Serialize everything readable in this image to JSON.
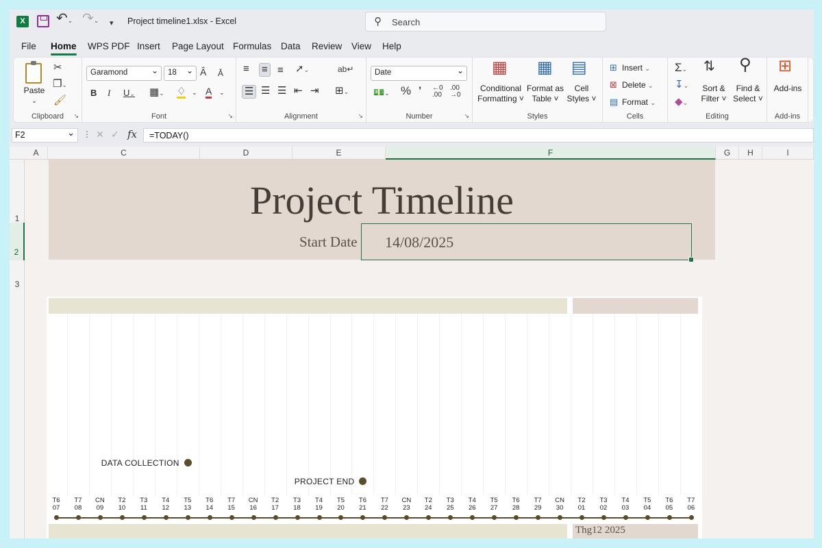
{
  "titlebar": {
    "doc_title": "Project timeline1.xlsx  -  Excel",
    "search_placeholder": "Search"
  },
  "menu": [
    "File",
    "Home",
    "WPS PDF",
    "Insert",
    "Page Layout",
    "Formulas",
    "Data",
    "Review",
    "View",
    "Help"
  ],
  "ribbon": {
    "clipboard": {
      "label": "Clipboard",
      "paste": "Paste"
    },
    "font": {
      "label": "Font",
      "family": "Garamond",
      "size": "18"
    },
    "alignment": {
      "label": "Alignment"
    },
    "number": {
      "label": "Number",
      "format": "Date"
    },
    "styles": {
      "label": "Styles",
      "conditional": [
        "Conditional",
        "Formatting ˅"
      ],
      "format_table": [
        "Format as",
        "Table ˅"
      ],
      "cell_styles": [
        "Cell",
        "Styles ˅"
      ]
    },
    "cells": {
      "label": "Cells",
      "insert": "Insert",
      "delete": "Delete",
      "format": "Format"
    },
    "editing": {
      "label": "Editing",
      "sort": [
        "Sort &",
        "Filter ˅"
      ],
      "find": [
        "Find &",
        "Select ˅"
      ]
    },
    "addins": {
      "label": "Add-ins",
      "btn": "Add-ins"
    }
  },
  "formula_bar": {
    "name_box": "F2",
    "formula": "=TODAY()"
  },
  "columns": [
    "A",
    "C",
    "D",
    "E",
    "F",
    "G",
    "H",
    "I"
  ],
  "rows": [
    "1",
    "2",
    "3"
  ],
  "sheet": {
    "title": "Project Timeline",
    "start_label": "Start Date",
    "start_value": "14/08/2025",
    "milestones": [
      {
        "label": "DATA COLLECTION",
        "day_index": 6
      },
      {
        "label": "PROJECT END",
        "day_index": 14
      }
    ],
    "days": [
      [
        "T6",
        "07"
      ],
      [
        "T7",
        "08"
      ],
      [
        "CN",
        "09"
      ],
      [
        "T2",
        "10"
      ],
      [
        "T3",
        "11"
      ],
      [
        "T4",
        "12"
      ],
      [
        "T5",
        "13"
      ],
      [
        "T6",
        "14"
      ],
      [
        "T7",
        "15"
      ],
      [
        "CN",
        "16"
      ],
      [
        "T2",
        "17"
      ],
      [
        "T3",
        "18"
      ],
      [
        "T4",
        "19"
      ],
      [
        "T5",
        "20"
      ],
      [
        "T6",
        "21"
      ],
      [
        "T7",
        "22"
      ],
      [
        "CN",
        "23"
      ],
      [
        "T2",
        "24"
      ],
      [
        "T3",
        "25"
      ],
      [
        "T4",
        "26"
      ],
      [
        "T5",
        "27"
      ],
      [
        "T6",
        "28"
      ],
      [
        "T7",
        "29"
      ],
      [
        "CN",
        "30"
      ],
      [
        "T2",
        "01"
      ],
      [
        "T3",
        "02"
      ],
      [
        "T4",
        "03"
      ],
      [
        "T5",
        "04"
      ],
      [
        "T6",
        "05"
      ],
      [
        "T7",
        "06"
      ]
    ],
    "month_label": "Thg12 2025"
  }
}
